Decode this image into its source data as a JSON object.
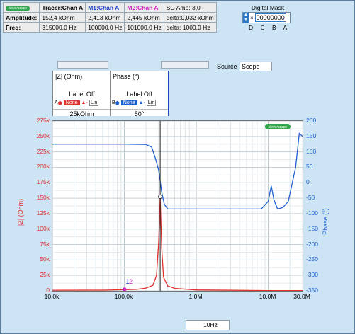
{
  "measurements": {
    "headers": {
      "tracer": "Tracer:Chan A",
      "m1": "M1:Chan A",
      "m2": "M2:Chan A",
      "sg": "SG Amp: 3,0"
    },
    "logo_text": "cleverscope",
    "rows": [
      {
        "label": "Amplitude:",
        "tracer": "152,4 kOhm",
        "m1": "2,413 kOhm",
        "m2": "2,445 kOhm",
        "extra": "delta:0,032 kOhm"
      },
      {
        "label": "Freq:",
        "tracer": "315000,0 Hz",
        "m1": "100000,0 Hz",
        "m2": "101000,0 Hz",
        "extra": "delta: 1000,0 Hz"
      }
    ],
    "colors": {
      "m1": "#1a3cc8",
      "m2": "#d020c0"
    }
  },
  "digital_mask": {
    "title": "Digital Mask",
    "value": "00000000",
    "bits": "D C B A"
  },
  "source": {
    "label": "Source",
    "value": "Scope"
  },
  "channels": {
    "impedance": {
      "name": "|Z| (Ohm)",
      "label_state": "Label Off",
      "letter": "A",
      "none": "None",
      "scale": "Lin",
      "value": "25kOhm",
      "color": "#e03030"
    },
    "phase": {
      "name": "Phase (°)",
      "label_state": "Label Off",
      "letter": "B",
      "none": "None",
      "scale": "Lin",
      "value": "50°",
      "color": "#2060d0"
    }
  },
  "chart_data": {
    "type": "line",
    "xscale": "log",
    "xlim": [
      10000,
      30000000
    ],
    "x_ticks": [
      "10,0k",
      "100,0k",
      "1,0M",
      "10,0M",
      "30,0M"
    ],
    "y_left": {
      "label": "|Z| (Ohm)",
      "ylim": [
        0,
        275000
      ],
      "ticks": [
        "275k",
        "250k",
        "225k",
        "200k",
        "175k",
        "150k",
        "125k",
        "100k",
        "75k",
        "50k",
        "25k",
        "0"
      ]
    },
    "y_right": {
      "label": "Phase (°)",
      "ylim": [
        -350,
        200
      ],
      "ticks": [
        "200",
        "150",
        "100",
        "50",
        "0",
        "-50",
        "-100",
        "-150",
        "-200",
        "-250",
        "-300",
        "-350"
      ]
    },
    "series": [
      {
        "axis": "left",
        "color": "#e03030",
        "x": [
          10000,
          50000,
          100000,
          150000,
          200000,
          250000,
          280000,
          300000,
          315000,
          330000,
          350000,
          400000,
          500000,
          1000000,
          10000000,
          30000000
        ],
        "y": [
          1000,
          1200,
          1800,
          2500,
          4500,
          9000,
          25000,
          80000,
          152400,
          70000,
          22000,
          8000,
          4000,
          1500,
          500,
          400
        ]
      },
      {
        "axis": "right",
        "color": "#2060d0",
        "x": [
          10000,
          100000,
          200000,
          240000,
          270000,
          300000,
          330000,
          360000,
          400000,
          1000000,
          5000000,
          8000000,
          10000000,
          11000000,
          12000000,
          13500000,
          16000000,
          19000000,
          24000000,
          27000000,
          30000000
        ],
        "y": [
          125,
          125,
          124,
          115,
          80,
          40,
          -30,
          -70,
          -85,
          -85,
          -85,
          -85,
          -60,
          -10,
          -55,
          -85,
          -80,
          -60,
          50,
          160,
          150
        ]
      }
    ],
    "markers": [
      {
        "label": "1",
        "x": 100000,
        "y": 2413,
        "color": "#2040c0"
      },
      {
        "label": "2",
        "x": 101000,
        "y": 2445,
        "color": "#d020c0"
      }
    ],
    "tracer": {
      "x": 315000,
      "y": 152400
    },
    "cursor_label": "10Hz",
    "logo": "cleverscope"
  }
}
